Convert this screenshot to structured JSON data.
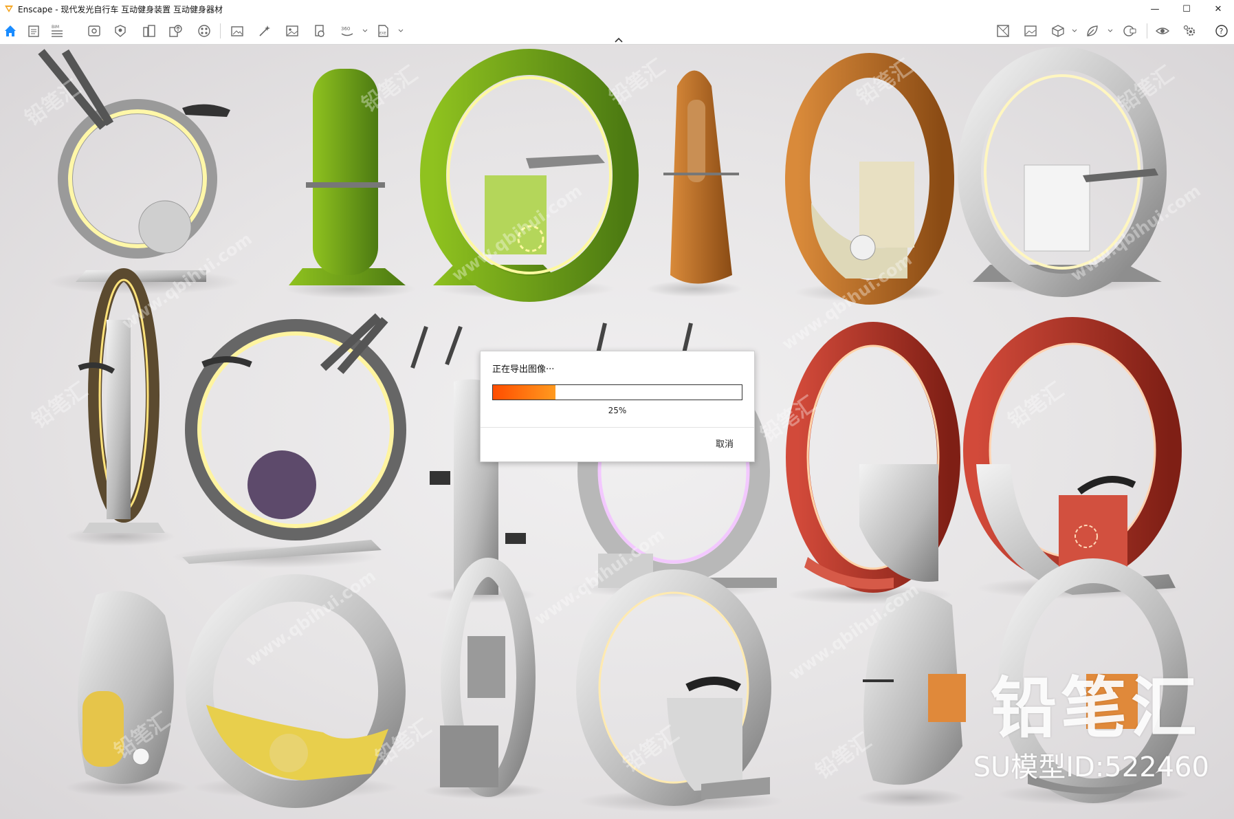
{
  "window": {
    "title": "Enscape - 现代发光自行车 互动健身装置 互动健身器材",
    "minimize": "—",
    "maximize": "☐",
    "close": "✕"
  },
  "toolbar": {
    "accent": "#1a8cff",
    "left_icons": [
      "home-icon",
      "properties-icon",
      "bim-icon",
      "view-icon",
      "asset-icon",
      "library-icon",
      "upload-icon",
      "material-icon",
      "screenshot-icon",
      "effects-icon",
      "image-icon",
      "batch-icon",
      "panorama-icon",
      "export-exe-icon"
    ],
    "right_icons": [
      "site-context-icon",
      "media-icon",
      "cube-icon",
      "leaf-icon",
      "vr-headset-icon",
      "visual-settings-icon",
      "gear-icon",
      "help-icon"
    ],
    "bim_label": "BIM"
  },
  "dialog": {
    "title": "正在导出图像···",
    "progress": 0.25,
    "progress_text": "25%",
    "cancel_label": "取消"
  },
  "watermark": {
    "brand": "铅笔汇",
    "model_id": "SU模型ID:522460",
    "site": "www.qbihui.com"
  }
}
